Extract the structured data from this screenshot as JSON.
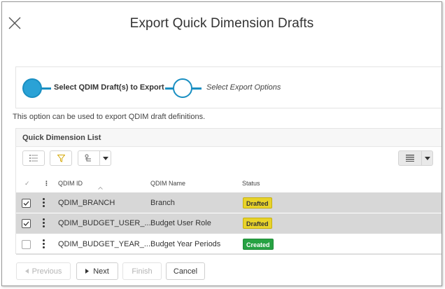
{
  "window": {
    "title": "Export Quick Dimension Drafts"
  },
  "steps": [
    {
      "label": "Select QDIM Draft(s) to Export",
      "state": "active"
    },
    {
      "label": "Select Export Options",
      "state": "inactive"
    }
  ],
  "description": "This option can be used to export QDIM draft definitions.",
  "panel": {
    "title": "Quick Dimension List"
  },
  "columns": {
    "check": "✓",
    "menu": "⋮",
    "id": "QDIM ID",
    "name": "QDIM Name",
    "status": "Status"
  },
  "rows": [
    {
      "id": "QDIM_BRANCH",
      "name": "Branch",
      "status": "Drafted",
      "checked": true
    },
    {
      "id": "QDIM_BUDGET_USER_...",
      "name": "Budget User Role",
      "status": "Drafted",
      "checked": true
    },
    {
      "id": "QDIM_BUDGET_YEAR_...",
      "name": "Budget Year Periods",
      "status": "Created",
      "checked": false
    }
  ],
  "footer": {
    "previous": "Previous",
    "next": "Next",
    "finish": "Finish",
    "cancel": "Cancel"
  },
  "colors": {
    "accent": "#1a8fc2",
    "drafted": "#e8d32a",
    "created": "#27a243",
    "selected_row": "#d7d7d7"
  },
  "icons": [
    "close-icon",
    "list-icon",
    "filter-icon",
    "group-icon",
    "dropdown-icon",
    "view-lines-icon",
    "sort-asc-icon",
    "kebab-icon",
    "checkbox-icon",
    "caret-left-icon",
    "caret-right-icon"
  ]
}
